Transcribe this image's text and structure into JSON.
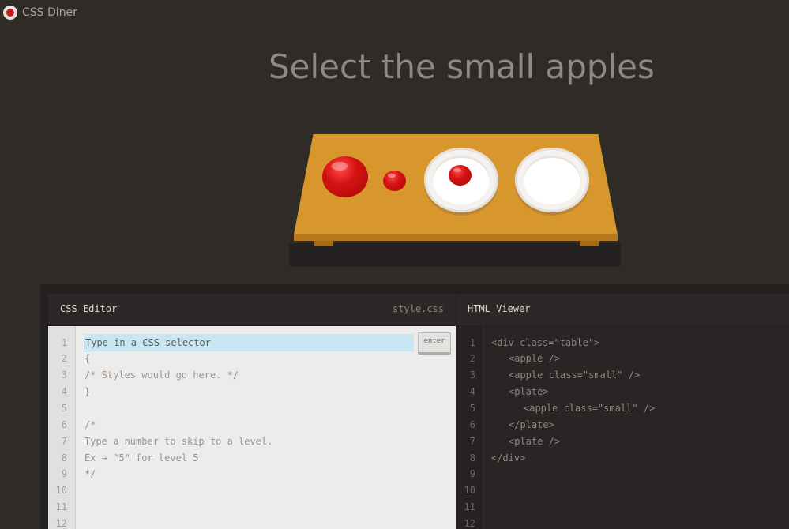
{
  "app": {
    "title": "CSS Diner"
  },
  "level": {
    "instruction": "Select the small apples"
  },
  "css_editor": {
    "label": "CSS Editor",
    "file_name": "style.css",
    "input_placeholder": "Type in a CSS selector",
    "enter_label": "enter",
    "line_numbers": [
      "1",
      "2",
      "3",
      "4",
      "5",
      "6",
      "7",
      "8",
      "9",
      "10",
      "11",
      "12"
    ],
    "lines": [
      "",
      "{",
      "/* Styles would go here. */",
      "}",
      "",
      "/*",
      "Type a number to skip to a level.",
      "Ex → \"5\" for level 5",
      "*/",
      "",
      "",
      ""
    ]
  },
  "html_viewer": {
    "label": "HTML Viewer",
    "line_numbers": [
      "1",
      "2",
      "3",
      "4",
      "5",
      "6",
      "7",
      "8",
      "9",
      "10",
      "11",
      "12"
    ],
    "lines": [
      "<div class=\"table\">",
      "<apple />",
      "<apple class=\"small\" />",
      "<plate>",
      "<apple class=\"small\" />",
      "</plate>",
      "<plate />",
      "</div>",
      "",
      "",
      "",
      ""
    ]
  },
  "colors": {
    "background": "#2f2b27",
    "table": "#d8972c",
    "apple": "#d51212",
    "plate": "#ffffff",
    "input_highlight": "#c9e6f2"
  }
}
